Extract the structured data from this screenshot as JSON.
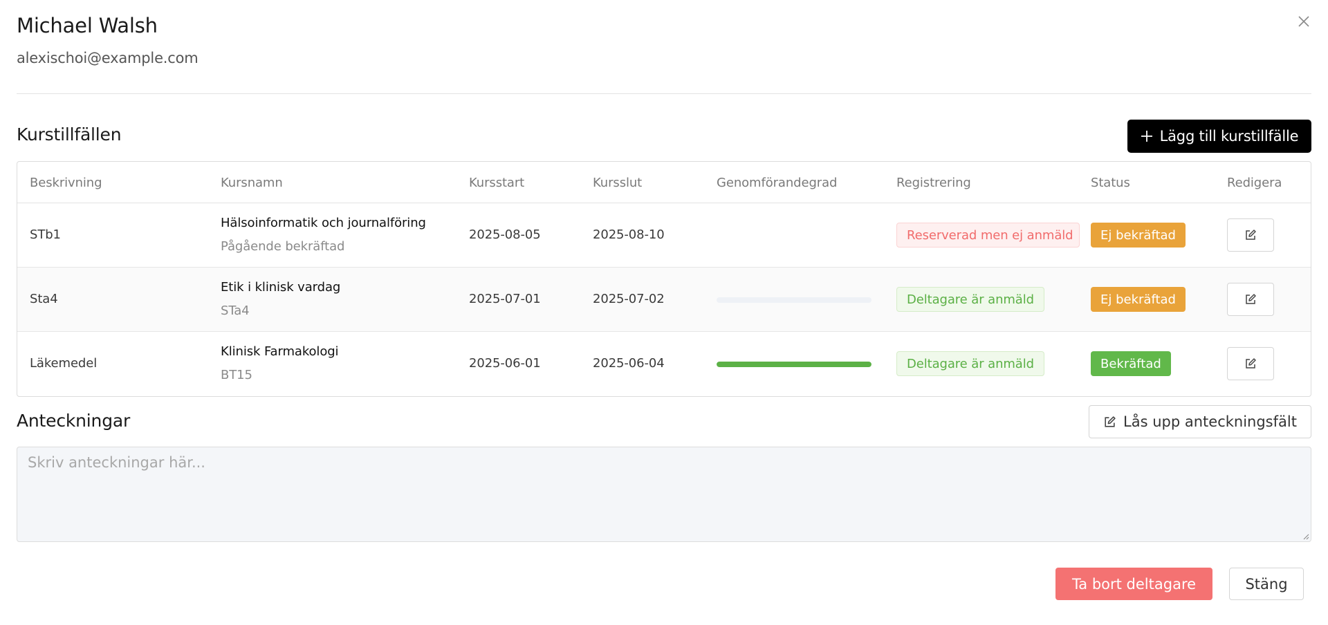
{
  "participant": {
    "name": "Michael Walsh",
    "email": "alexischoi@example.com"
  },
  "sections": {
    "courses_title": "Kurstillfällen",
    "notes_title": "Anteckningar"
  },
  "buttons": {
    "add_course": "Lägg till kurstillfälle",
    "unlock_notes": "Lås upp anteckningsfält",
    "remove_participant": "Ta bort deltagare",
    "close": "Stäng"
  },
  "table": {
    "headers": {
      "description": "Beskrivning",
      "course_name": "Kursnamn",
      "course_start": "Kursstart",
      "course_end": "Kursslut",
      "completion": "Genomförandegrad",
      "registration": "Registrering",
      "status": "Status",
      "edit": "Redigera"
    },
    "rows": [
      {
        "description": "STb1",
        "course_name": "Hälsoinformatik och journalföring",
        "course_sub": "Pågående bekräftad",
        "start": "2025-08-05",
        "end": "2025-08-10",
        "completion": null,
        "registration": "Reserverad men ej anmäld",
        "registration_type": "red",
        "status": "Ej bekräftad",
        "status_type": "orange"
      },
      {
        "description": "Sta4",
        "course_name": "Etik i klinisk vardag",
        "course_sub": "STa4",
        "start": "2025-07-01",
        "end": "2025-07-02",
        "completion": 0,
        "registration": "Deltagare är anmäld",
        "registration_type": "green",
        "status": "Ej bekräftad",
        "status_type": "orange"
      },
      {
        "description": "Läkemedel",
        "course_name": "Klinisk Farmakologi",
        "course_sub": "BT15",
        "start": "2025-06-01",
        "end": "2025-06-04",
        "completion": 100,
        "registration": "Deltagare är anmäld",
        "registration_type": "green",
        "status": "Bekräftad",
        "status_type": "green"
      }
    ]
  },
  "notes": {
    "placeholder": "Skriv anteckningar här...",
    "value": ""
  },
  "icons": {
    "close": "close-icon",
    "add": "plus-icon",
    "edit": "edit-icon",
    "unlock": "edit-icon"
  },
  "colors": {
    "primary_dark": "#000000",
    "danger": "#f47272",
    "warning": "#e9a33a",
    "success": "#61b84a",
    "progress_track": "#eef1f6"
  }
}
